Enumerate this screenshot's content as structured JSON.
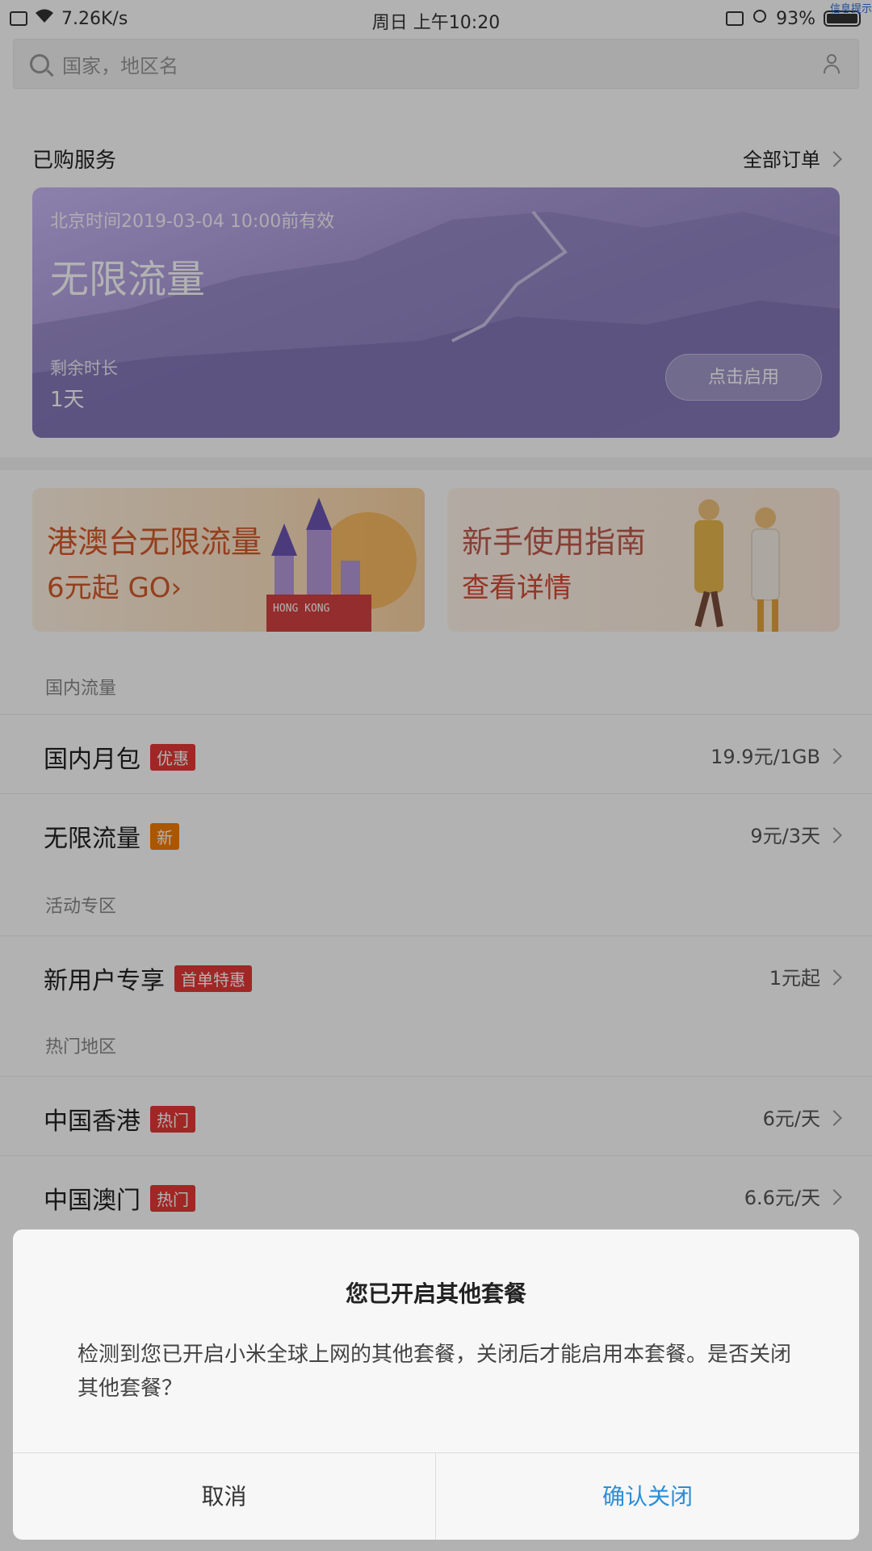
{
  "status_bar": {
    "net_speed": "7.26K/s",
    "datetime": "周日  上午10:20",
    "battery": "93%",
    "corner_tag": "信息提示"
  },
  "search": {
    "placeholder": "国家，地区名"
  },
  "purchased": {
    "section_title": "已购服务",
    "all_orders": "全部订单",
    "card": {
      "valid_text": "北京时间2019-03-04 10:00前有效",
      "title": "无限流量",
      "remaining_label": "剩余时长",
      "remaining_value": "1天",
      "activate_label": "点击启用"
    }
  },
  "banners": [
    {
      "line1": "港澳台无限流量",
      "line2": "6元起 GO›"
    },
    {
      "line1": "新手使用指南",
      "line2": "查看详情"
    }
  ],
  "categories": {
    "domestic": "国内流量",
    "activity": "活动专区",
    "hot": "热门地区"
  },
  "rows": [
    {
      "name": "国内月包",
      "badge": "优惠",
      "price": "19.9元/1GB"
    },
    {
      "name": "无限流量",
      "badge": "新",
      "price": "9元/3天"
    },
    {
      "name": "新用户专享",
      "badge": "首单特惠",
      "price": "1元起"
    },
    {
      "name": "中国香港",
      "badge": "热门",
      "price": "6元/天"
    },
    {
      "name": "中国澳门",
      "badge": "热门",
      "price": "6.6元/天"
    }
  ],
  "dialog": {
    "title": "您已开启其他套餐",
    "message": "检测到您已开启小米全球上网的其他套餐，关闭后才能启用本套餐。是否关闭其他套餐？",
    "cancel": "取消",
    "confirm": "确认关闭"
  },
  "colors": {
    "card_purple": "#a99ad8",
    "badge_red": "#e53935",
    "badge_orange": "#f57c00",
    "confirm_blue": "#2a8ed7"
  }
}
